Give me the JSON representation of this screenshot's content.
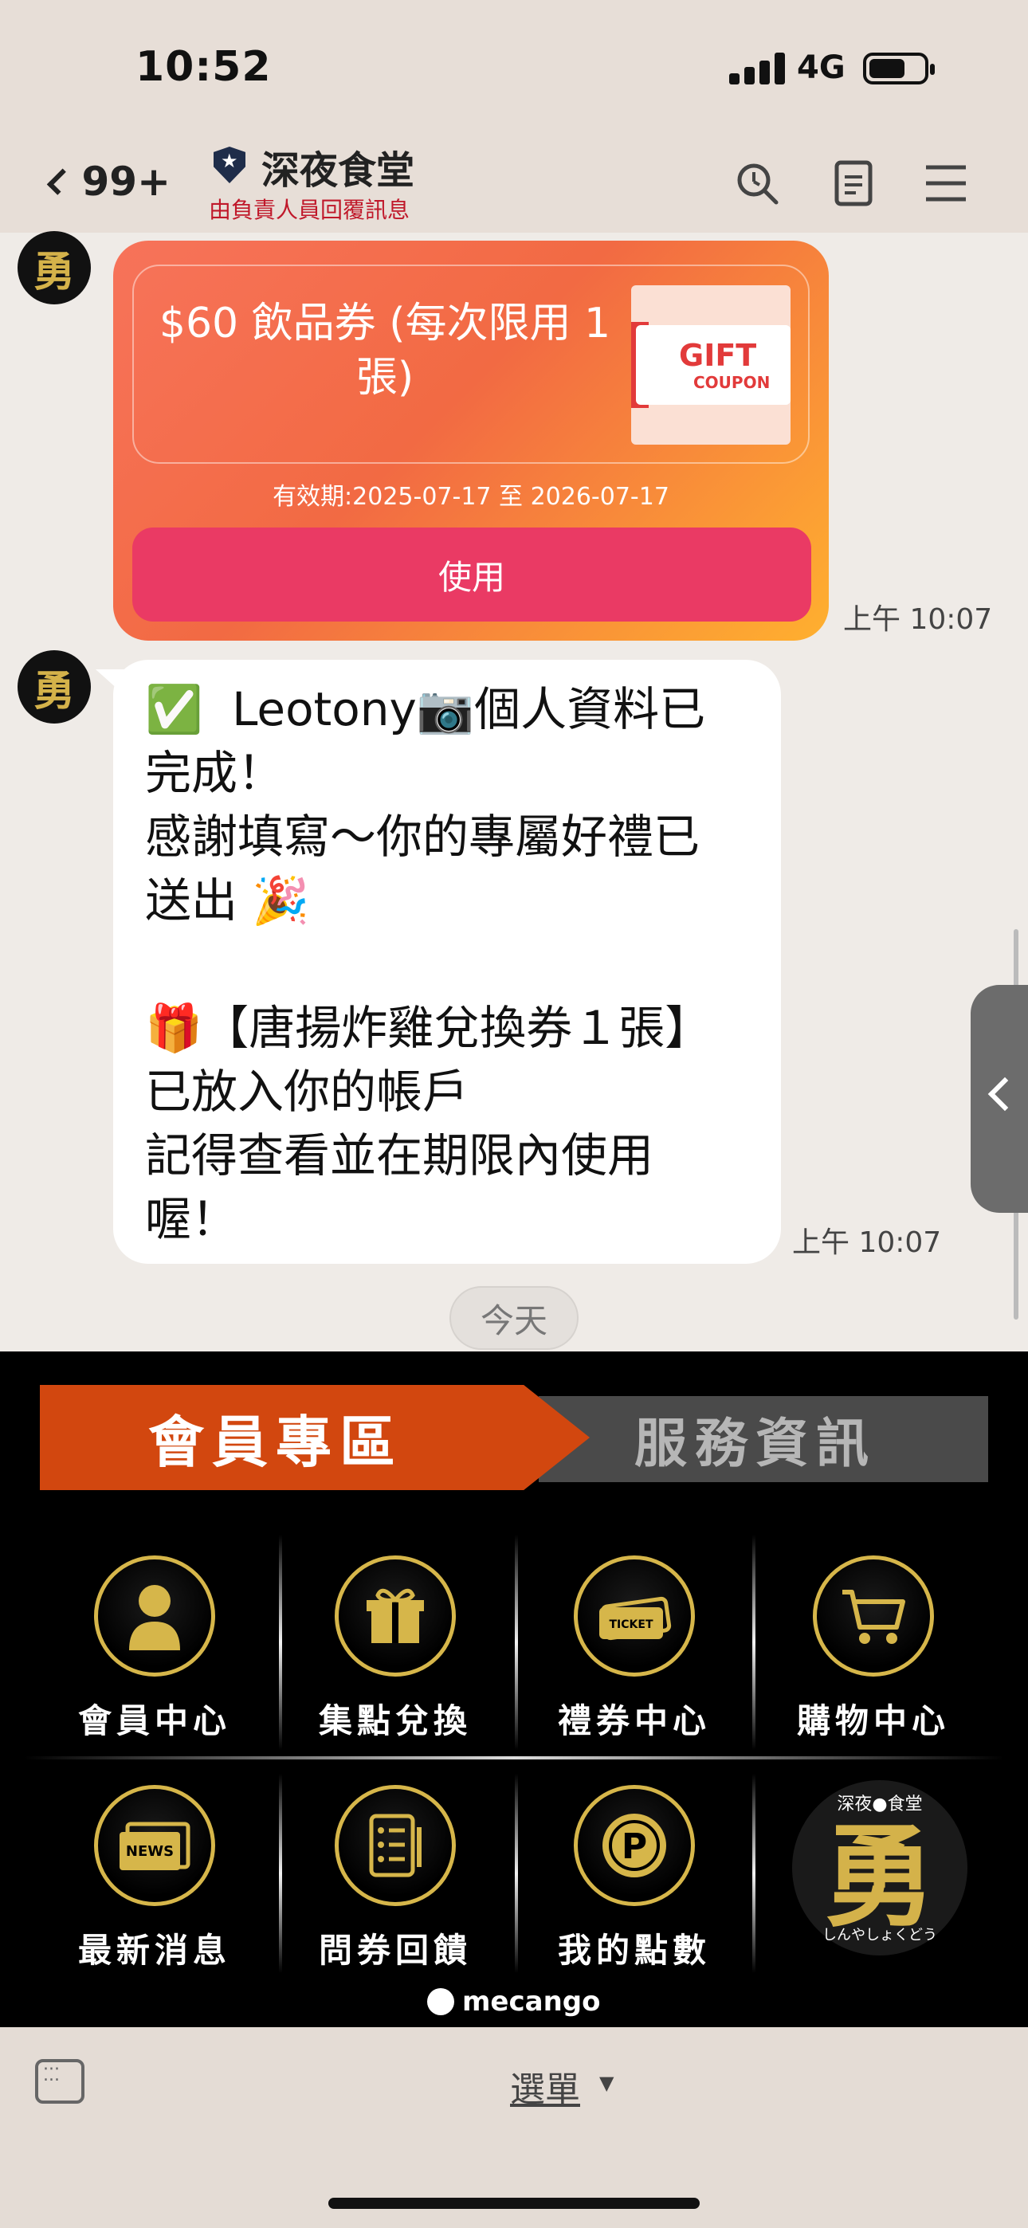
{
  "status": {
    "time": "10:52",
    "network": "4G"
  },
  "header": {
    "back_count": "99+",
    "title": "深夜食堂",
    "subtitle": "由負責人員回覆訊息"
  },
  "coupon": {
    "title": "$60 飲品券 (每次限用 1 張)",
    "gift_text": "GIFT",
    "gift_sub": "COUPON",
    "validity": "有效期:2025-07-17 至 2026-07-17",
    "button": "使用",
    "timestamp": "上午 10:07"
  },
  "message": {
    "text": "✅  Leotony📷個人資料已\n完成！\n感謝填寫～你的專屬好禮已\n送出 🎉\n\n🎁【唐揚炸雞兌換券１張】\n已放入你的帳戶\n記得查看並在期限內使用\n喔！",
    "timestamp": "上午 10:07"
  },
  "day_divider": "今天",
  "richmenu": {
    "tab_active": "會員專區",
    "tab_inactive": "服務資訊",
    "items": [
      {
        "label": "會員中心",
        "icon": "member-icon"
      },
      {
        "label": "集點兌換",
        "icon": "gift-icon"
      },
      {
        "label": "禮券中心",
        "icon": "ticket-icon"
      },
      {
        "label": "購物中心",
        "icon": "cart-icon"
      },
      {
        "label": "最新消息",
        "icon": "news-icon"
      },
      {
        "label": "問券回饋",
        "icon": "survey-icon"
      },
      {
        "label": "我的點數",
        "icon": "points-icon"
      }
    ],
    "powered_by": "mecango"
  },
  "bottom": {
    "menu_label": "選單"
  },
  "colors": {
    "accent_red": "#ea3a64",
    "gold": "#d6b64a",
    "tab_orange": "#d2470f"
  }
}
